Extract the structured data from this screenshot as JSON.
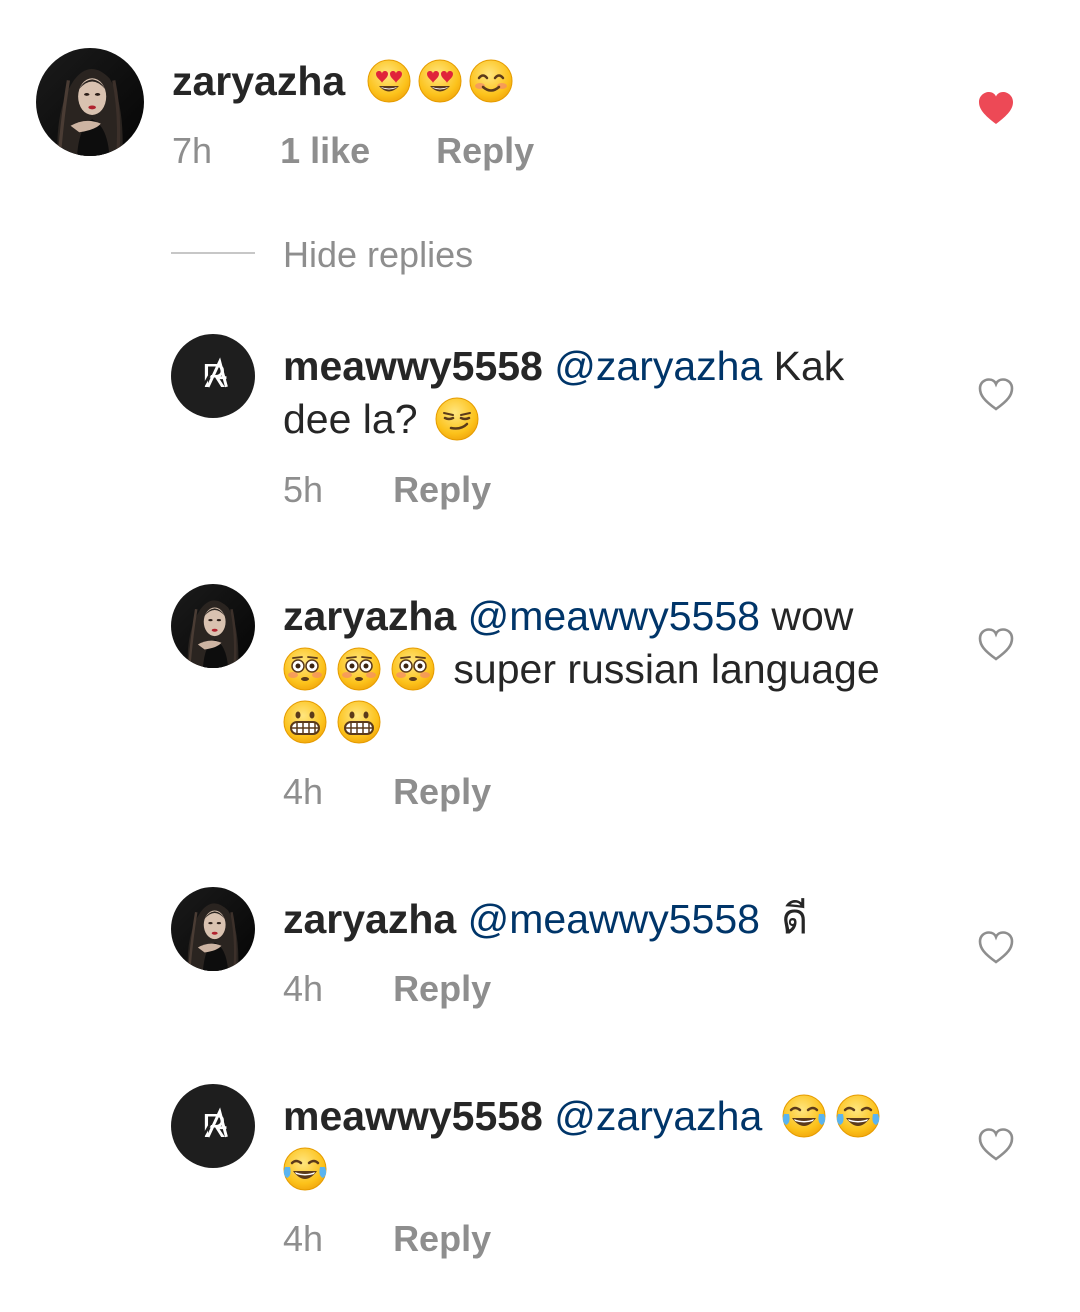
{
  "comment": {
    "username": "zaryazha",
    "emojis": [
      "heart-eyes",
      "heart-eyes",
      "smiling-blush"
    ],
    "time": "7h",
    "likes": "1 like",
    "reply_label": "Reply",
    "liked": true,
    "heart_color": "#ed4956"
  },
  "hide_replies_label": "Hide replies",
  "replies": [
    {
      "username": "meawwy5558",
      "mention": "@zaryazha",
      "text_1": "Kak",
      "text_2": "dee la?",
      "emojis": [
        "smirk"
      ],
      "time": "5h",
      "reply_label": "Reply"
    },
    {
      "username": "zaryazha",
      "mention": "@meawwy5558",
      "text_1": "wow",
      "text_2": "super russian language",
      "emojis_line2": [
        "flushed",
        "flushed",
        "flushed"
      ],
      "emojis_line3": [
        "grimace",
        "grimace"
      ],
      "time": "4h",
      "reply_label": "Reply"
    },
    {
      "username": "zaryazha",
      "mention": "@meawwy5558",
      "text_1": "ดี",
      "time": "4h",
      "reply_label": "Reply"
    },
    {
      "username": "meawwy5558",
      "mention": "@zaryazha",
      "emojis_line1": [
        "tears-of-joy",
        "tears-of-joy"
      ],
      "emojis_line2": [
        "tears-of-joy"
      ],
      "time": "4h",
      "reply_label": "Reply"
    }
  ],
  "colors": {
    "text": "#262626",
    "mention": "#003569",
    "secondary": "#8e8e8e",
    "liked_heart": "#ed4956",
    "outline_heart": "#8e8e8e"
  }
}
